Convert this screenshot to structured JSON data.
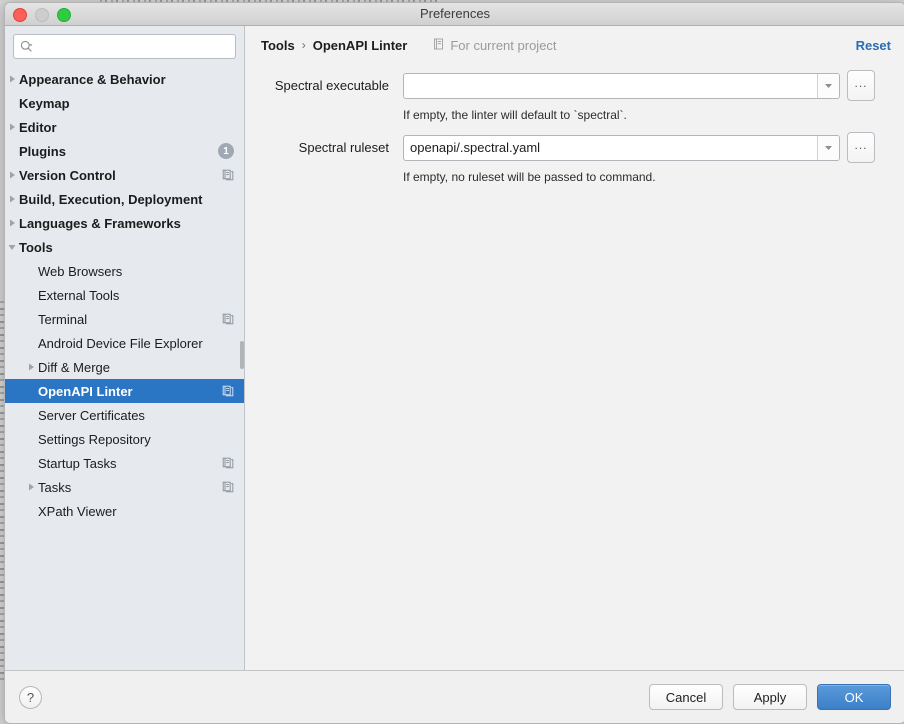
{
  "window": {
    "title": "Preferences",
    "traffic_lights": [
      "close",
      "minimize",
      "zoom"
    ]
  },
  "sidebar": {
    "search": {
      "value": "",
      "placeholder": ""
    },
    "items": [
      {
        "label": "Appearance & Behavior",
        "level": 0,
        "bold": true,
        "twisty": "collapsed",
        "badge": null,
        "scope_icon": false,
        "selected": false
      },
      {
        "label": "Keymap",
        "level": 0,
        "bold": true,
        "twisty": "none",
        "badge": null,
        "scope_icon": false,
        "selected": false
      },
      {
        "label": "Editor",
        "level": 0,
        "bold": true,
        "twisty": "collapsed",
        "badge": null,
        "scope_icon": false,
        "selected": false
      },
      {
        "label": "Plugins",
        "level": 0,
        "bold": true,
        "twisty": "none",
        "badge": "1",
        "scope_icon": false,
        "selected": false
      },
      {
        "label": "Version Control",
        "level": 0,
        "bold": true,
        "twisty": "collapsed",
        "badge": null,
        "scope_icon": true,
        "selected": false
      },
      {
        "label": "Build, Execution, Deployment",
        "level": 0,
        "bold": true,
        "twisty": "collapsed",
        "badge": null,
        "scope_icon": false,
        "selected": false
      },
      {
        "label": "Languages & Frameworks",
        "level": 0,
        "bold": true,
        "twisty": "collapsed",
        "badge": null,
        "scope_icon": false,
        "selected": false
      },
      {
        "label": "Tools",
        "level": 0,
        "bold": true,
        "twisty": "expanded",
        "badge": null,
        "scope_icon": false,
        "selected": false
      },
      {
        "label": "Web Browsers",
        "level": 1,
        "bold": false,
        "twisty": "none",
        "badge": null,
        "scope_icon": false,
        "selected": false
      },
      {
        "label": "External Tools",
        "level": 1,
        "bold": false,
        "twisty": "none",
        "badge": null,
        "scope_icon": false,
        "selected": false
      },
      {
        "label": "Terminal",
        "level": 1,
        "bold": false,
        "twisty": "none",
        "badge": null,
        "scope_icon": true,
        "selected": false
      },
      {
        "label": "Android Device File Explorer",
        "level": 1,
        "bold": false,
        "twisty": "none",
        "badge": null,
        "scope_icon": false,
        "selected": false
      },
      {
        "label": "Diff & Merge",
        "level": 1,
        "bold": false,
        "twisty": "collapsed",
        "badge": null,
        "scope_icon": false,
        "selected": false
      },
      {
        "label": "OpenAPI Linter",
        "level": 1,
        "bold": true,
        "twisty": "none",
        "badge": null,
        "scope_icon": true,
        "selected": true
      },
      {
        "label": "Server Certificates",
        "level": 1,
        "bold": false,
        "twisty": "none",
        "badge": null,
        "scope_icon": false,
        "selected": false
      },
      {
        "label": "Settings Repository",
        "level": 1,
        "bold": false,
        "twisty": "none",
        "badge": null,
        "scope_icon": false,
        "selected": false
      },
      {
        "label": "Startup Tasks",
        "level": 1,
        "bold": false,
        "twisty": "none",
        "badge": null,
        "scope_icon": true,
        "selected": false
      },
      {
        "label": "Tasks",
        "level": 1,
        "bold": false,
        "twisty": "collapsed",
        "badge": null,
        "scope_icon": true,
        "selected": false
      },
      {
        "label": "XPath Viewer",
        "level": 1,
        "bold": false,
        "twisty": "none",
        "badge": null,
        "scope_icon": false,
        "selected": false
      }
    ]
  },
  "content": {
    "breadcrumb": {
      "parent": "Tools",
      "separator": "›",
      "current": "OpenAPI Linter"
    },
    "project_scope_label": "For current project",
    "reset_label": "Reset",
    "fields": [
      {
        "label": "Spectral executable",
        "value": "",
        "placeholder": "",
        "hint": "If empty, the linter will default to `spectral`.",
        "browse_label": "..."
      },
      {
        "label": "Spectral ruleset",
        "value": "openapi/.spectral.yaml",
        "placeholder": "",
        "hint": "If empty, no ruleset will be passed to command.",
        "browse_label": "..."
      }
    ]
  },
  "footer": {
    "help_label": "?",
    "cancel_label": "Cancel",
    "apply_label": "Apply",
    "ok_label": "OK"
  },
  "colors": {
    "selection_blue": "#2a75c4",
    "accent_link": "#2a6db5",
    "primary_button": "#3d80c8",
    "sidebar_bg": "#e6eaee",
    "content_bg": "#f2f2f2"
  }
}
